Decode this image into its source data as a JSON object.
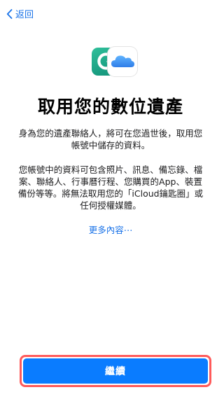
{
  "nav": {
    "back_label": "返回",
    "back_icon": "chevron-left-icon"
  },
  "hero": {
    "icons": [
      "account-recovery-icon",
      "icloud-icon"
    ],
    "green_color": "#1ba586",
    "cloud_color": "#3e8ef7"
  },
  "content": {
    "title": "取用您的數位遺產",
    "paragraph1": "身為您的遺產聯絡人，將可在您過世後，取用您帳號中儲存的資料。",
    "paragraph2": "您帳號中的資料可包含照片、訊息、備忘錄、檔案、聯絡人、行事曆行程、您購買的App、裝置備份等等。將無法取用您的「iCloud鑰匙圈」或任何授權媒體。",
    "more_link": "更多內容⋯"
  },
  "footer": {
    "continue_label": "繼續",
    "button_color": "#0a7cff",
    "highlight_color": "#ff5a5a"
  }
}
